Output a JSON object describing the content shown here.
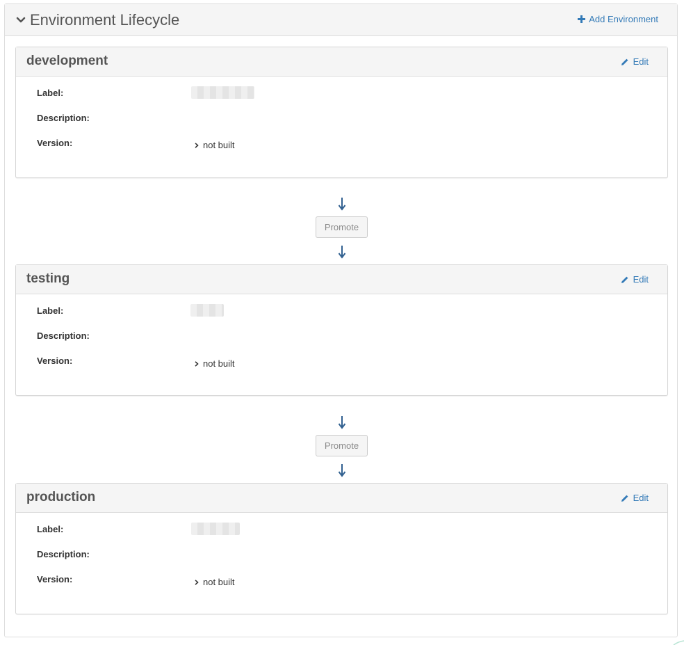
{
  "panel": {
    "title": "Environment Lifecycle",
    "collapse_icon": "chevron-down-icon",
    "add_environment_label": "Add Environment",
    "add_icon": "plus-icon"
  },
  "fields": {
    "label": "Label:",
    "description": "Description:",
    "version": "Version:"
  },
  "environments": [
    {
      "name": "development",
      "edit_label": "Edit",
      "description": "",
      "version": "not built"
    },
    {
      "name": "testing",
      "edit_label": "Edit",
      "description": "",
      "version": "not built"
    },
    {
      "name": "production",
      "edit_label": "Edit",
      "description": "",
      "version": "not built"
    }
  ],
  "promote_buttons": [
    {
      "label": "Promote"
    },
    {
      "label": "Promote"
    }
  ],
  "colors": {
    "link": "#337ab7",
    "arrow": "#2f5f8f",
    "header_bg": "#f5f5f5",
    "border": "#dddddd"
  }
}
